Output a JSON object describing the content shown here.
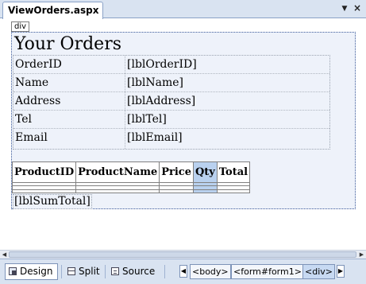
{
  "tab": {
    "title": "ViewOrders.aspx",
    "menu_glyph": "▼",
    "close_glyph": "×"
  },
  "designer": {
    "element_badge": "div",
    "page_title": "Your Orders",
    "fields": [
      {
        "label": "OrderID",
        "value": "[lblOrderID]"
      },
      {
        "label": "Name",
        "value": "[lblName]"
      },
      {
        "label": "Address",
        "value": "[lblAddress]"
      },
      {
        "label": "Tel",
        "value": "[lblTel]"
      },
      {
        "label": "Email",
        "value": "[lblEmail]"
      }
    ],
    "grid_columns": [
      "ProductID",
      "ProductName",
      "Price",
      "Qty",
      "Total"
    ],
    "selected_column": "Qty",
    "sum_total": "[lblSumTotal]"
  },
  "scrollbar": {
    "left_arrow": "◀",
    "right_arrow": "▶"
  },
  "bottom_bar": {
    "views": [
      {
        "label": "Design",
        "icon": "design-view-icon",
        "active": true
      },
      {
        "label": "Split",
        "icon": "split-view-icon",
        "active": false
      },
      {
        "label": "Source",
        "icon": "source-view-icon",
        "active": false
      }
    ],
    "nav_left": "◀",
    "nav_right": "▶",
    "breadcrumbs": [
      "<body>",
      "<form#form1>",
      "<div>"
    ],
    "active_crumb": "<div>"
  },
  "colors": {
    "chrome": "#d9e3f1",
    "selection": "#b9d1ef",
    "div_background": "#eef2fa"
  }
}
